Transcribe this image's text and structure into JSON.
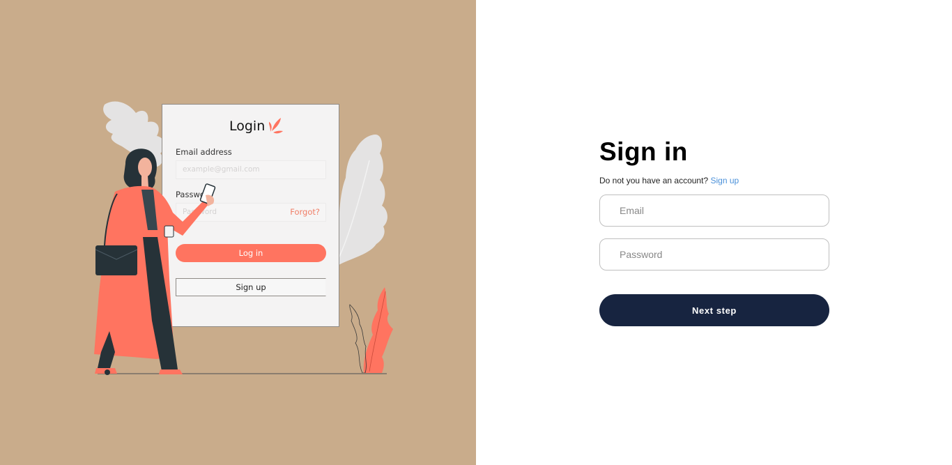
{
  "illustration": {
    "card_title": "Login",
    "email_label": "Email address",
    "email_placeholder": "example@gmail.com",
    "password_label": "Password",
    "password_placeholder": "Password",
    "forgot_link": "Forgot?",
    "login_button": "Log in",
    "signup_button": "Sign up"
  },
  "form": {
    "heading": "Sign in",
    "account_prompt": "Do not you have an account?",
    "signup_link": "Sign up",
    "email_placeholder": "Email",
    "password_placeholder": "Password",
    "next_button": "Next step"
  },
  "colors": {
    "left_panel_bg": "#c9ac8b",
    "accent_coral": "#ff7460",
    "button_navy": "#172440",
    "link_blue": "#4a90d9"
  }
}
